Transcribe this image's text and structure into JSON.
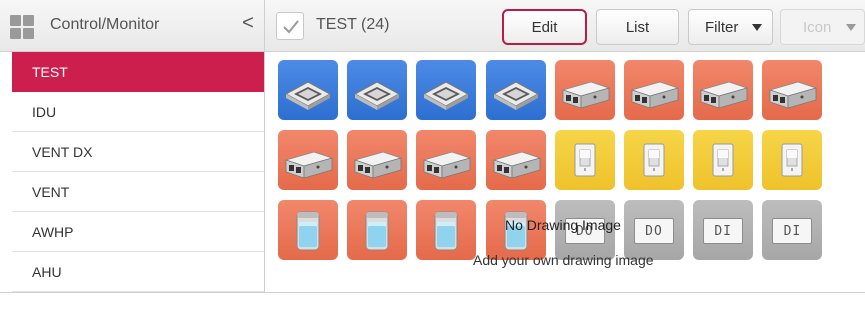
{
  "header": {
    "title": "Control/Monitor",
    "collapse_glyph": "<",
    "group_title": "TEST (24)",
    "buttons": {
      "edit": "Edit",
      "list": "List",
      "filter": "Filter",
      "icon": "Icon"
    },
    "accent_color": "#b51d4a"
  },
  "sidebar": {
    "active_color": "#cc1f4e",
    "items": [
      {
        "label": "TEST",
        "active": true
      },
      {
        "label": "IDU",
        "active": false
      },
      {
        "label": "VENT DX",
        "active": false
      },
      {
        "label": "VENT",
        "active": false
      },
      {
        "label": "AWHP",
        "active": false
      },
      {
        "label": "AHU",
        "active": false
      }
    ]
  },
  "devices": [
    {
      "icon": "ceiling-cassette-icon",
      "color": "blue"
    },
    {
      "icon": "ceiling-cassette-icon",
      "color": "blue"
    },
    {
      "icon": "ceiling-cassette-icon",
      "color": "blue"
    },
    {
      "icon": "ceiling-cassette-icon",
      "color": "blue"
    },
    {
      "icon": "ventilation-unit-icon",
      "color": "orange"
    },
    {
      "icon": "ventilation-unit-icon",
      "color": "orange"
    },
    {
      "icon": "ventilation-unit-icon",
      "color": "orange"
    },
    {
      "icon": "ventilation-unit-icon",
      "color": "orange"
    },
    {
      "icon": "ventilation-unit-icon",
      "color": "orange"
    },
    {
      "icon": "ventilation-unit-icon",
      "color": "orange"
    },
    {
      "icon": "ventilation-unit-icon",
      "color": "orange"
    },
    {
      "icon": "ventilation-unit-icon",
      "color": "orange"
    },
    {
      "icon": "light-switch-icon",
      "color": "yellow"
    },
    {
      "icon": "light-switch-icon",
      "color": "yellow"
    },
    {
      "icon": "light-switch-icon",
      "color": "yellow"
    },
    {
      "icon": "light-switch-icon",
      "color": "yellow"
    },
    {
      "icon": "water-tank-icon",
      "color": "orange"
    },
    {
      "icon": "water-tank-icon",
      "color": "orange"
    },
    {
      "icon": "water-tank-icon",
      "color": "orange"
    },
    {
      "icon": "water-tank-icon",
      "color": "orange"
    },
    {
      "icon": "point-label",
      "color": "gray",
      "label": "DO"
    },
    {
      "icon": "point-label",
      "color": "gray",
      "label": "DO"
    },
    {
      "icon": "point-label",
      "color": "gray",
      "label": "DI"
    },
    {
      "icon": "point-label",
      "color": "gray",
      "label": "DI"
    }
  ],
  "overlay": {
    "line1": "No Drawing Image",
    "line2": "Add your own drawing image"
  }
}
